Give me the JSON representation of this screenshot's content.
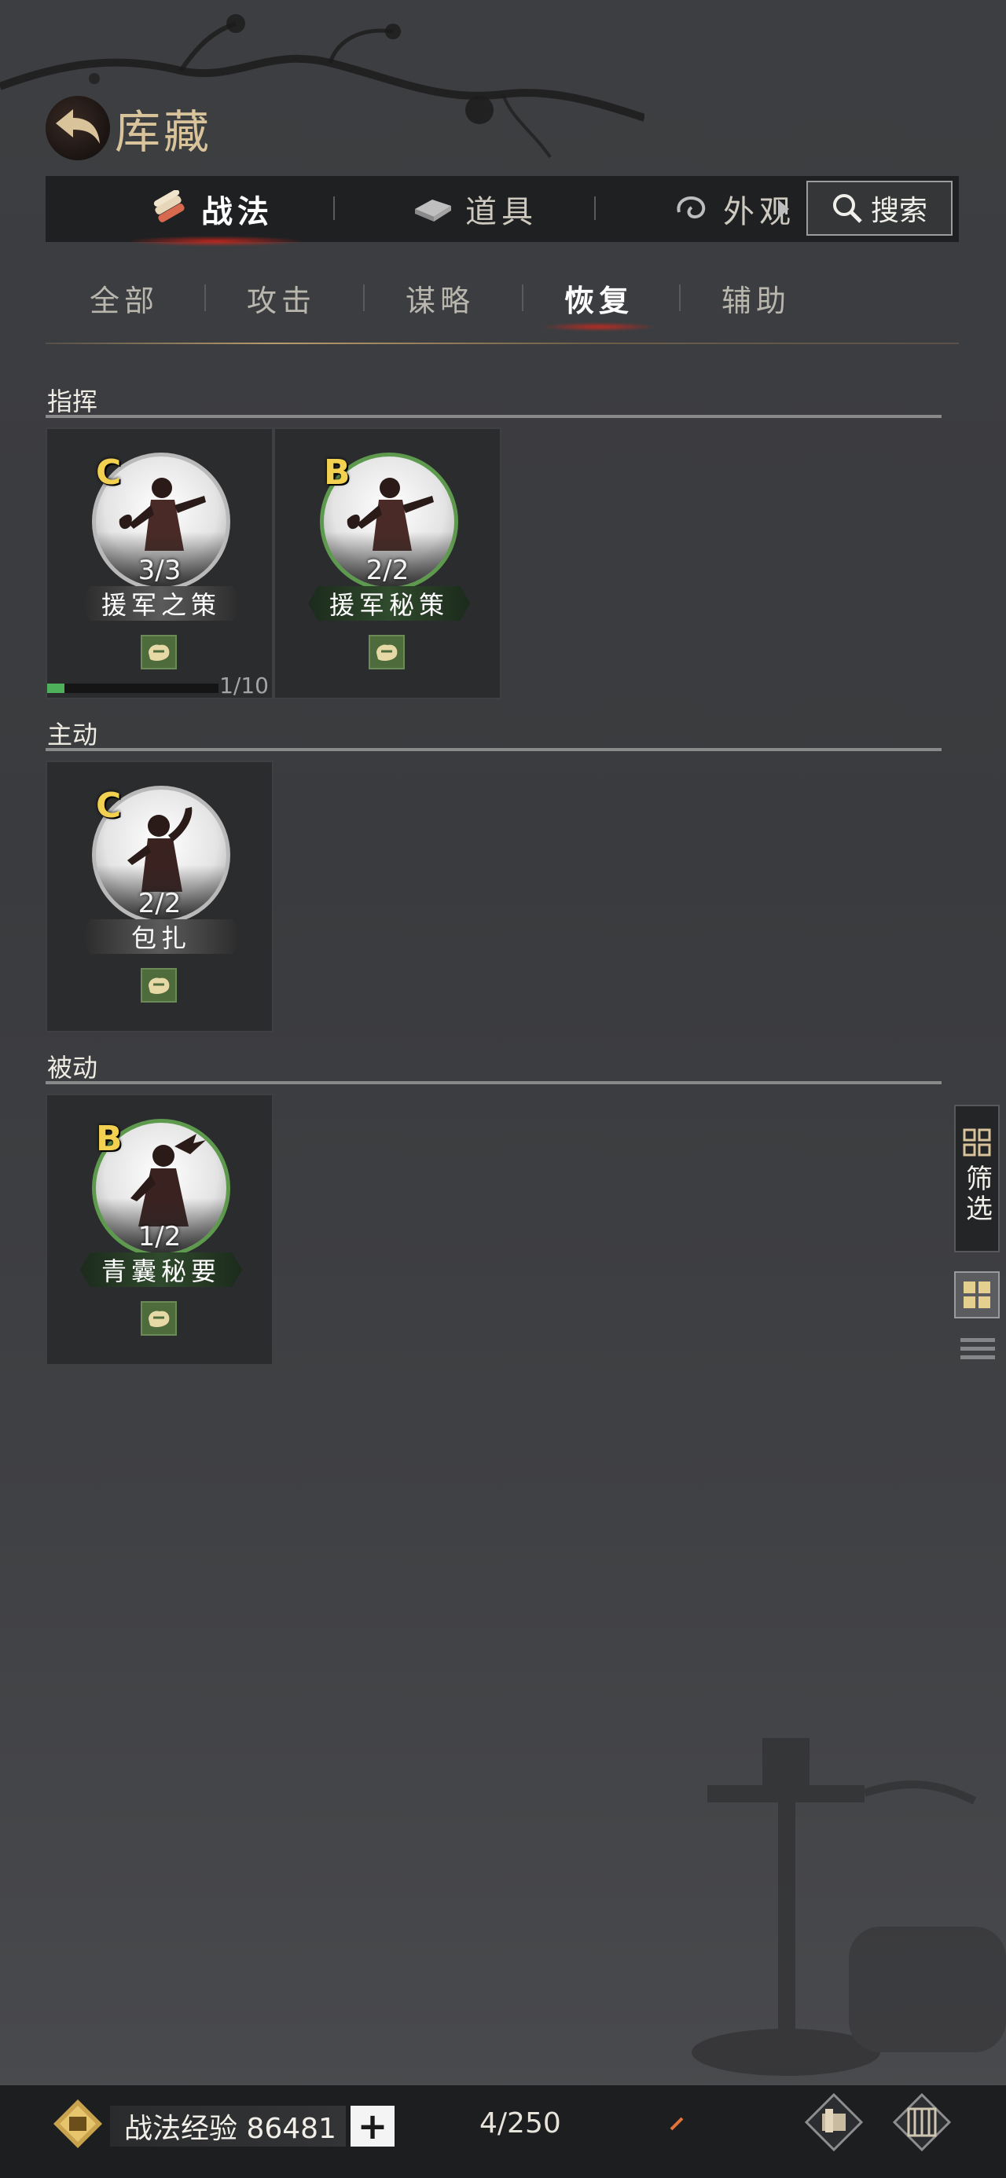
{
  "header": {
    "title": "库藏"
  },
  "top_tabs": [
    {
      "label": "战法",
      "icon": "scroll-bundle-icon",
      "active": true
    },
    {
      "label": "道具",
      "icon": "ingot-icon",
      "active": false
    },
    {
      "label": "外观",
      "icon": "swirl-icon",
      "active": false
    }
  ],
  "search": {
    "label": "搜索"
  },
  "sub_tabs": [
    {
      "label": "全部",
      "active": false
    },
    {
      "label": "攻击",
      "active": false
    },
    {
      "label": "谋略",
      "active": false
    },
    {
      "label": "恢复",
      "active": true
    },
    {
      "label": "辅助",
      "active": false
    }
  ],
  "sections": [
    {
      "title": "指挥",
      "cards": [
        {
          "grade": "C",
          "count": "3/3",
          "name": "援军之策",
          "exp": "1/10",
          "exp_fraction": 0.1
        },
        {
          "grade": "B",
          "count": "2/2",
          "name": "援军秘策"
        }
      ]
    },
    {
      "title": "主动",
      "cards": [
        {
          "grade": "C",
          "count": "2/2",
          "name": "包扎"
        }
      ]
    },
    {
      "title": "被动",
      "cards": [
        {
          "grade": "B",
          "count": "1/2",
          "name": "青囊秘要"
        }
      ]
    }
  ],
  "side": {
    "filter_label": "筛选"
  },
  "bottom": {
    "exp_label": "战法经验 86481",
    "plus": "+",
    "capacity": "4/250"
  },
  "colors": {
    "grade_text": "#f2d050",
    "grade_c_ring": "#b9b9b9",
    "grade_b_ring": "#5e9a4e",
    "accent_red": "#d2281e",
    "gold": "#d8c39a"
  }
}
